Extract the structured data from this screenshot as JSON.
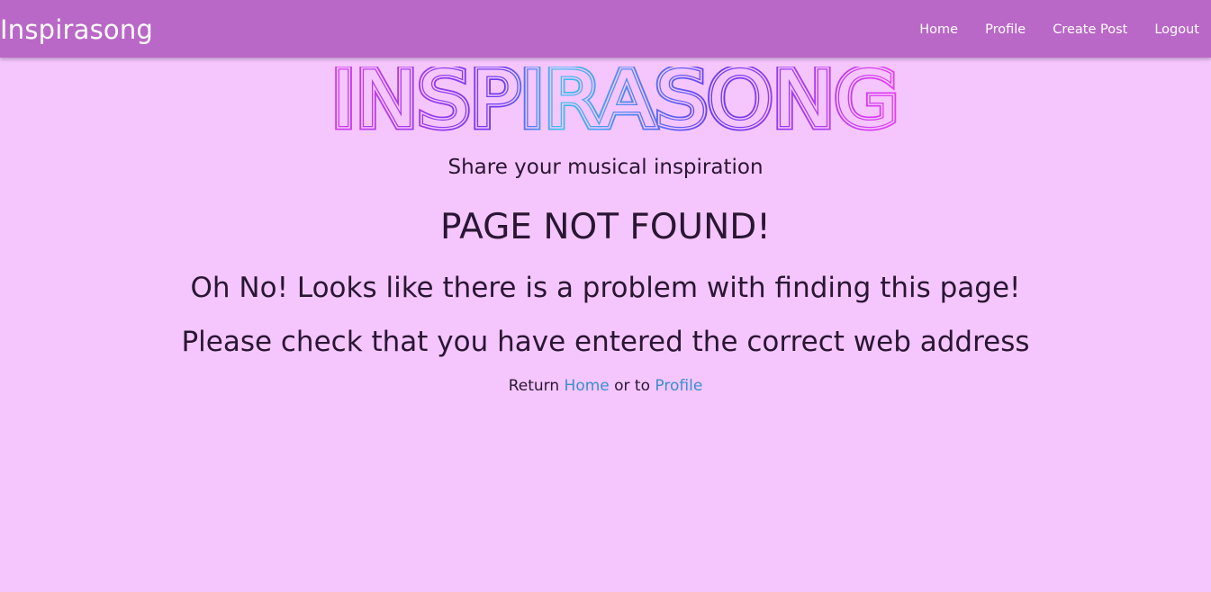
{
  "nav": {
    "brand": "Inspirasong",
    "links": [
      "Home",
      "Profile",
      "Create Post",
      "Logout"
    ]
  },
  "logo": {
    "text": "INSPIRASONG",
    "colors": [
      "#d53ce9",
      "#6a3af0",
      "#3cc3f0",
      "#e83ef0"
    ]
  },
  "hero": {
    "tagline": "Share your musical inspiration"
  },
  "error": {
    "title": "PAGE NOT FOUND!",
    "message1": "Oh No! Looks like there is a problem with finding this page!",
    "message2": "Please check that you have entered the correct web address",
    "return_prefix": "Return",
    "home_link": "Home",
    "middle": "or to",
    "profile_link": "Profile"
  },
  "colors": {
    "background": "#f5c6fe",
    "navbar": "#b968c7",
    "link": "#3a8fd0"
  }
}
